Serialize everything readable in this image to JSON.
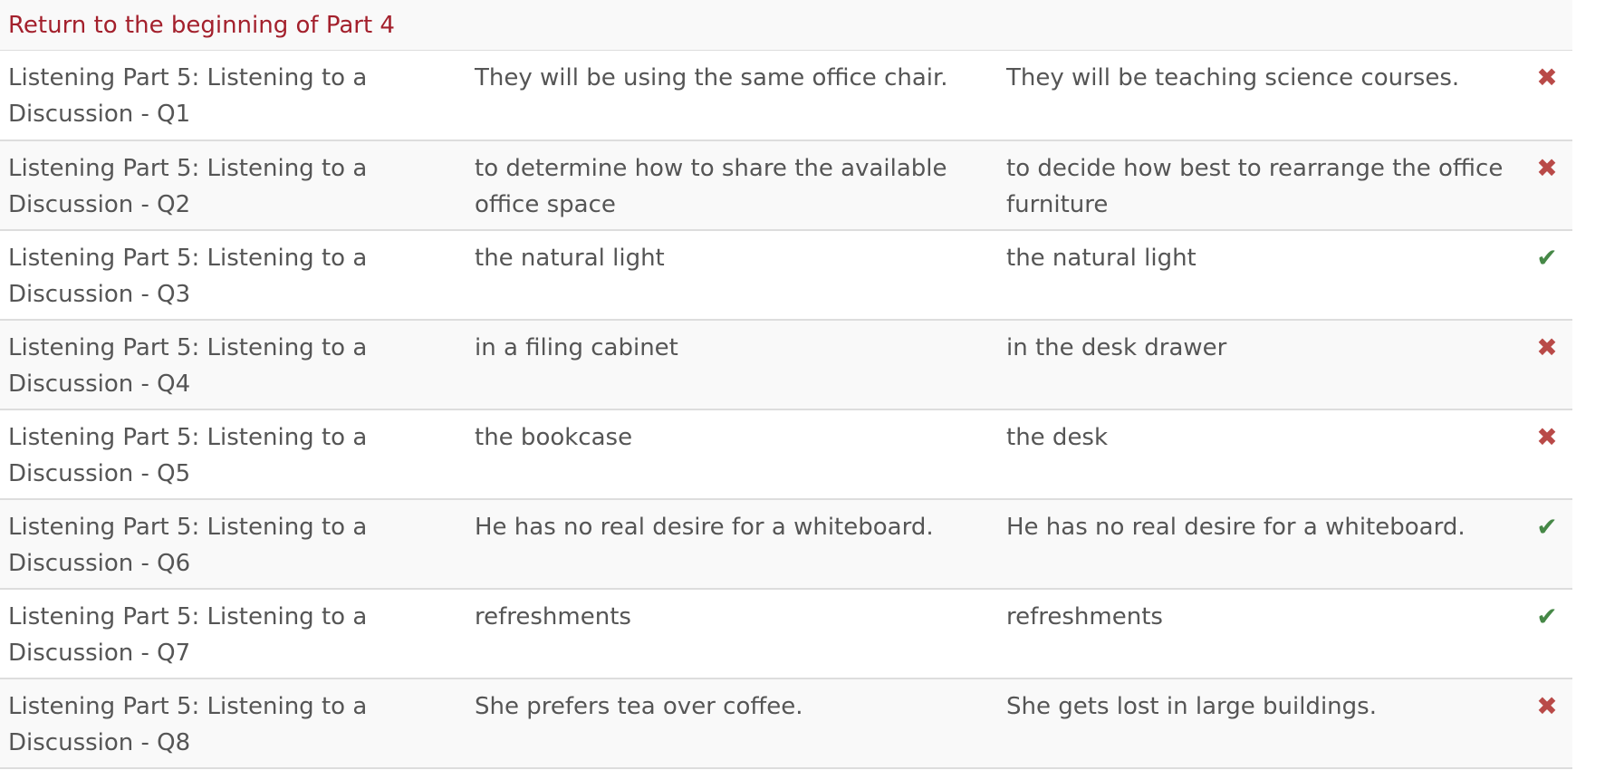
{
  "return_link": "Return to the beginning of Part 4",
  "colors": {
    "link": "#a3202c",
    "incorrect": "#b94a48",
    "correct": "#468847"
  },
  "rows": [
    {
      "question": "Listening Part 5: Listening to a Discussion - Q1",
      "your_answer": "They will be using the same office chair.",
      "correct_answer": "They will be teaching science courses.",
      "result": "incorrect",
      "icon": "cross-icon",
      "glyph": "✖"
    },
    {
      "question": "Listening Part 5: Listening to a Discussion - Q2",
      "your_answer": "to determine how to share the available office space",
      "correct_answer": "to decide how best to rearrange the office furniture",
      "result": "incorrect",
      "icon": "cross-icon",
      "glyph": "✖"
    },
    {
      "question": "Listening Part 5: Listening to a Discussion - Q3",
      "your_answer": "the natural light",
      "correct_answer": "the natural light",
      "result": "correct",
      "icon": "check-icon",
      "glyph": "✔"
    },
    {
      "question": "Listening Part 5: Listening to a Discussion - Q4",
      "your_answer": "in a filing cabinet",
      "correct_answer": "in the desk drawer",
      "result": "incorrect",
      "icon": "cross-icon",
      "glyph": "✖"
    },
    {
      "question": "Listening Part 5: Listening to a Discussion - Q5",
      "your_answer": "the bookcase",
      "correct_answer": "the desk",
      "result": "incorrect",
      "icon": "cross-icon",
      "glyph": "✖"
    },
    {
      "question": "Listening Part 5: Listening to a Discussion - Q6",
      "your_answer": "He has no real desire for a whiteboard.",
      "correct_answer": "He has no real desire for a whiteboard.",
      "result": "correct",
      "icon": "check-icon",
      "glyph": "✔"
    },
    {
      "question": "Listening Part 5: Listening to a Discussion - Q7",
      "your_answer": "refreshments",
      "correct_answer": "refreshments",
      "result": "correct",
      "icon": "check-icon",
      "glyph": "✔"
    },
    {
      "question": "Listening Part 5: Listening to a Discussion - Q8",
      "your_answer": "She prefers tea over coffee.",
      "correct_answer": "She gets lost in large buildings.",
      "result": "incorrect",
      "icon": "cross-icon",
      "glyph": "✖"
    }
  ]
}
